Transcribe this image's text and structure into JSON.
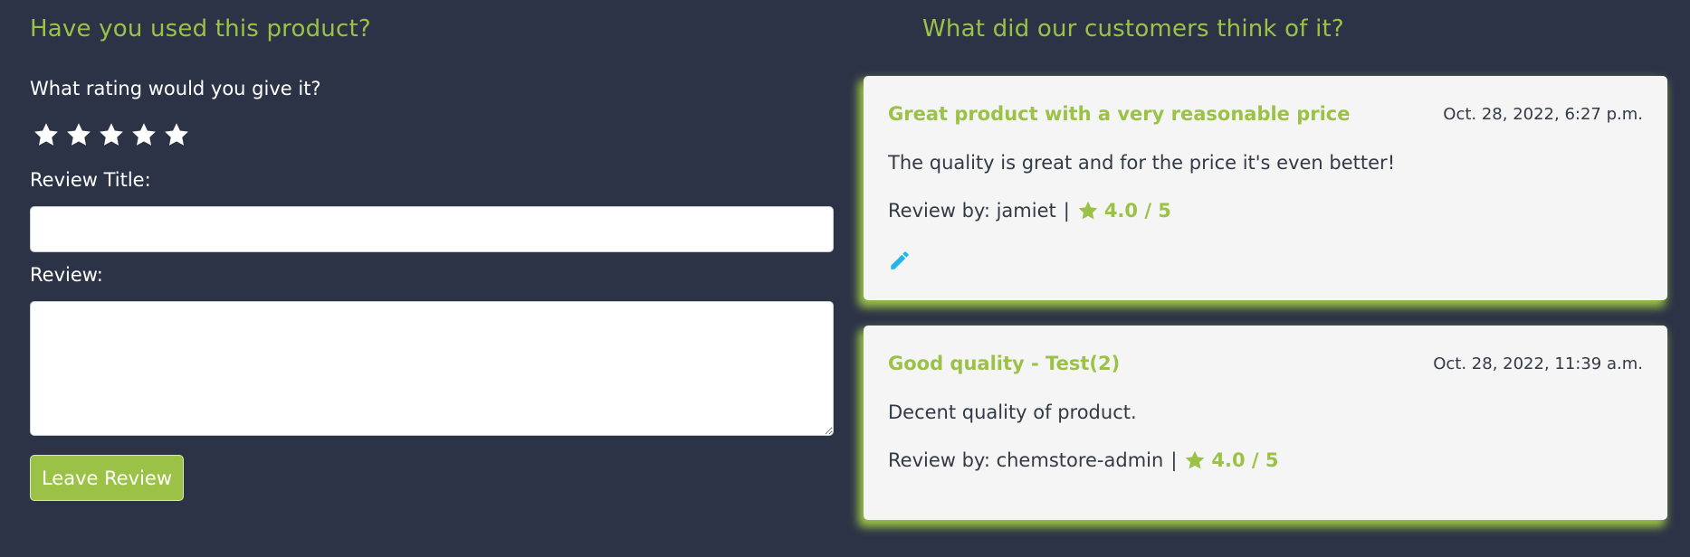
{
  "form": {
    "heading": "Have you used this product?",
    "rating_question": "What rating would you give it?",
    "stars_count": 5,
    "title_label": "Review Title:",
    "title_value": "",
    "review_label": "Review:",
    "review_value": "",
    "submit_label": "Leave Review"
  },
  "reviews": {
    "heading": "What did our customers think of it?",
    "items": [
      {
        "title": "Great product with a very reasonable price",
        "date": "Oct. 28, 2022, 6:27 p.m.",
        "body": "The quality is great and for the price it's even better!",
        "by_label": "Review by: jamiet",
        "separator": "|",
        "score": "4.0 / 5",
        "editable": true
      },
      {
        "title": "Good quality - Test(2)",
        "date": "Oct. 28, 2022, 11:39 a.m.",
        "body": "Decent quality of product.",
        "by_label": "Review by: chemstore-admin",
        "separator": "|",
        "score": "4.0 / 5",
        "editable": false
      }
    ]
  },
  "colors": {
    "background": "#2d3347",
    "accent": "#9bc247",
    "card": "#f5f5f5",
    "edit_icon": "#1fb6e8"
  },
  "icons": {
    "rating_star": "star-icon",
    "score_star": "star-icon",
    "edit": "pencil-icon"
  }
}
